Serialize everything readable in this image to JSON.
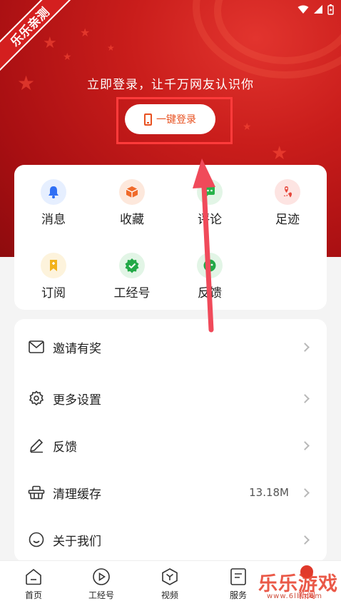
{
  "status_bar": {
    "icons": [
      "wifi-icon",
      "signal-icon",
      "battery-icon"
    ]
  },
  "corner_badge": {
    "text": "乐乐亲测"
  },
  "login": {
    "tip": "立即登录，让千万网友认识你",
    "button_label": "一键登录"
  },
  "quick_grid": [
    {
      "label": "消息",
      "icon": "bell-icon",
      "color": "#2f6ff5",
      "bg": "#e6efff"
    },
    {
      "label": "收藏",
      "icon": "box-icon",
      "color": "#f06a2a",
      "bg": "#fde8dc"
    },
    {
      "label": "评论",
      "icon": "chat-icon",
      "color": "#27b34a",
      "bg": "#e2f5e6"
    },
    {
      "label": "足迹",
      "icon": "footprint-icon",
      "color": "#e6463a",
      "bg": "#fde4e2"
    },
    {
      "label": "订阅",
      "icon": "bookmark-icon",
      "color": "#f2b21b",
      "bg": "#fdf3dc"
    },
    {
      "label": "工经号",
      "icon": "verified-icon",
      "color": "#22a947",
      "bg": "#e2f5e6"
    },
    {
      "label": "反馈",
      "icon": "feedback-icon",
      "color": "#22a947",
      "bg": "#e2f5e6"
    }
  ],
  "menu": [
    {
      "label": "邀请有奖",
      "icon": "mail-icon",
      "value": ""
    },
    {
      "label": "更多设置",
      "icon": "gear-icon",
      "value": ""
    },
    {
      "label": "反馈",
      "icon": "pencil-icon",
      "value": ""
    },
    {
      "label": "清理缓存",
      "icon": "basket-icon",
      "value": "13.18M"
    },
    {
      "label": "关于我们",
      "icon": "smile-icon",
      "value": ""
    }
  ],
  "tabs": [
    {
      "label": "首页",
      "icon": "home-icon"
    },
    {
      "label": "工经号",
      "icon": "play-icon"
    },
    {
      "label": "视频",
      "icon": "video-icon"
    },
    {
      "label": "服务",
      "icon": "document-icon"
    },
    {
      "label": "新闻",
      "icon": "news-icon"
    }
  ],
  "watermark": {
    "text": "乐乐游戏",
    "url": "www.6lll.com"
  }
}
